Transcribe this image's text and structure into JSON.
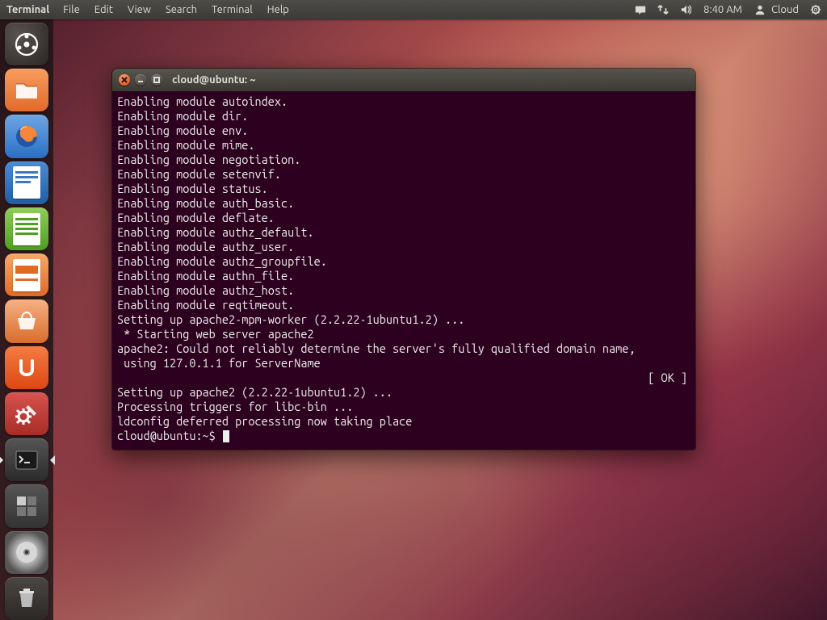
{
  "topbar": {
    "app_title": "Terminal",
    "menu": [
      "File",
      "Edit",
      "View",
      "Search",
      "Terminal",
      "Help"
    ],
    "clock": "8:40 AM",
    "user": "Cloud"
  },
  "launcher": {
    "items": [
      {
        "name": "dash-home",
        "tip": "Dash Home"
      },
      {
        "name": "nautilus",
        "tip": "Files"
      },
      {
        "name": "firefox",
        "tip": "Firefox"
      },
      {
        "name": "writer",
        "tip": "LibreOffice Writer"
      },
      {
        "name": "calc",
        "tip": "LibreOffice Calc"
      },
      {
        "name": "impress",
        "tip": "LibreOffice Impress"
      },
      {
        "name": "software-center",
        "tip": "Ubuntu Software Center"
      },
      {
        "name": "ubuntuone",
        "tip": "Ubuntu One"
      },
      {
        "name": "settings",
        "tip": "System Settings"
      },
      {
        "name": "terminal",
        "tip": "Terminal",
        "running": true,
        "active": true
      },
      {
        "name": "workspace",
        "tip": "Workspace Switcher"
      },
      {
        "name": "disc",
        "tip": "Disc"
      },
      {
        "name": "trash",
        "tip": "Trash"
      }
    ]
  },
  "terminal": {
    "title": "cloud@ubuntu: ~",
    "lines": [
      "Enabling module autoindex.",
      "Enabling module dir.",
      "Enabling module env.",
      "Enabling module mime.",
      "Enabling module negotiation.",
      "Enabling module setenvif.",
      "Enabling module status.",
      "Enabling module auth_basic.",
      "Enabling module deflate.",
      "Enabling module authz_default.",
      "Enabling module authz_user.",
      "Enabling module authz_groupfile.",
      "Enabling module authn_file.",
      "Enabling module authz_host.",
      "Enabling module reqtimeout.",
      "Setting up apache2-mpm-worker (2.2.22-1ubuntu1.2) ...",
      " * Starting web server apache2",
      "apache2: Could not reliably determine the server's fully qualified domain name,",
      " using 127.0.1.1 for ServerName"
    ],
    "ok_line": {
      "left": "",
      "right": "[ OK ]"
    },
    "lines2": [
      "Setting up apache2 (2.2.22-1ubuntu1.2) ...",
      "Processing triggers for libc-bin ...",
      "ldconfig deferred processing now taking place"
    ],
    "prompt": "cloud@ubuntu:~$ "
  }
}
